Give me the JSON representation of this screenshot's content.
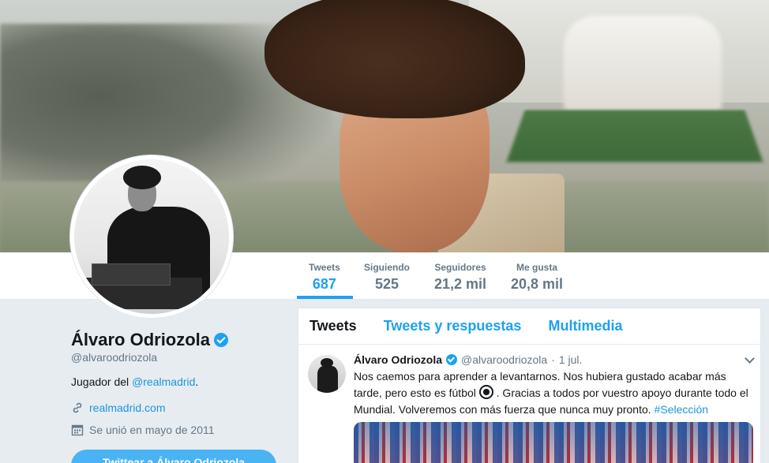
{
  "stats": [
    {
      "label": "Tweets",
      "value": "687"
    },
    {
      "label": "Siguiendo",
      "value": "525"
    },
    {
      "label": "Seguidores",
      "value": "21,2 mil"
    },
    {
      "label": "Me gusta",
      "value": "20,8 mil"
    }
  ],
  "profile": {
    "name": "Álvaro Odriozola",
    "handle": "@alvaroodriozola",
    "bio_prefix": "Jugador del ",
    "bio_link": "@realmadrid",
    "bio_suffix": ".",
    "website": "realmadrid.com",
    "joined": "Se unió en mayo de 2011",
    "tweet_to_label": "Twittear a Álvaro Odriozola"
  },
  "timeline": {
    "tabs": [
      "Tweets",
      "Tweets y respuestas",
      "Multimedia"
    ],
    "tweet": {
      "name": "Álvaro Odriozola",
      "handle": "@alvaroodriozola",
      "dot": "·",
      "time": "1 jul.",
      "text_part1": "Nos caemos para aprender a levantarnos. Nos hubiera gustado acabar más tarde, pero esto es fútbol ",
      "text_part2": " . Gracias a todos por vuestro apoyo durante todo el Mundial. Volveremos con más fuerza que nunca muy pronto. ",
      "hashtag": "#Selección"
    }
  },
  "colors": {
    "accent": "#1da1f2",
    "link": "#1b95e0",
    "muted": "#657786"
  }
}
